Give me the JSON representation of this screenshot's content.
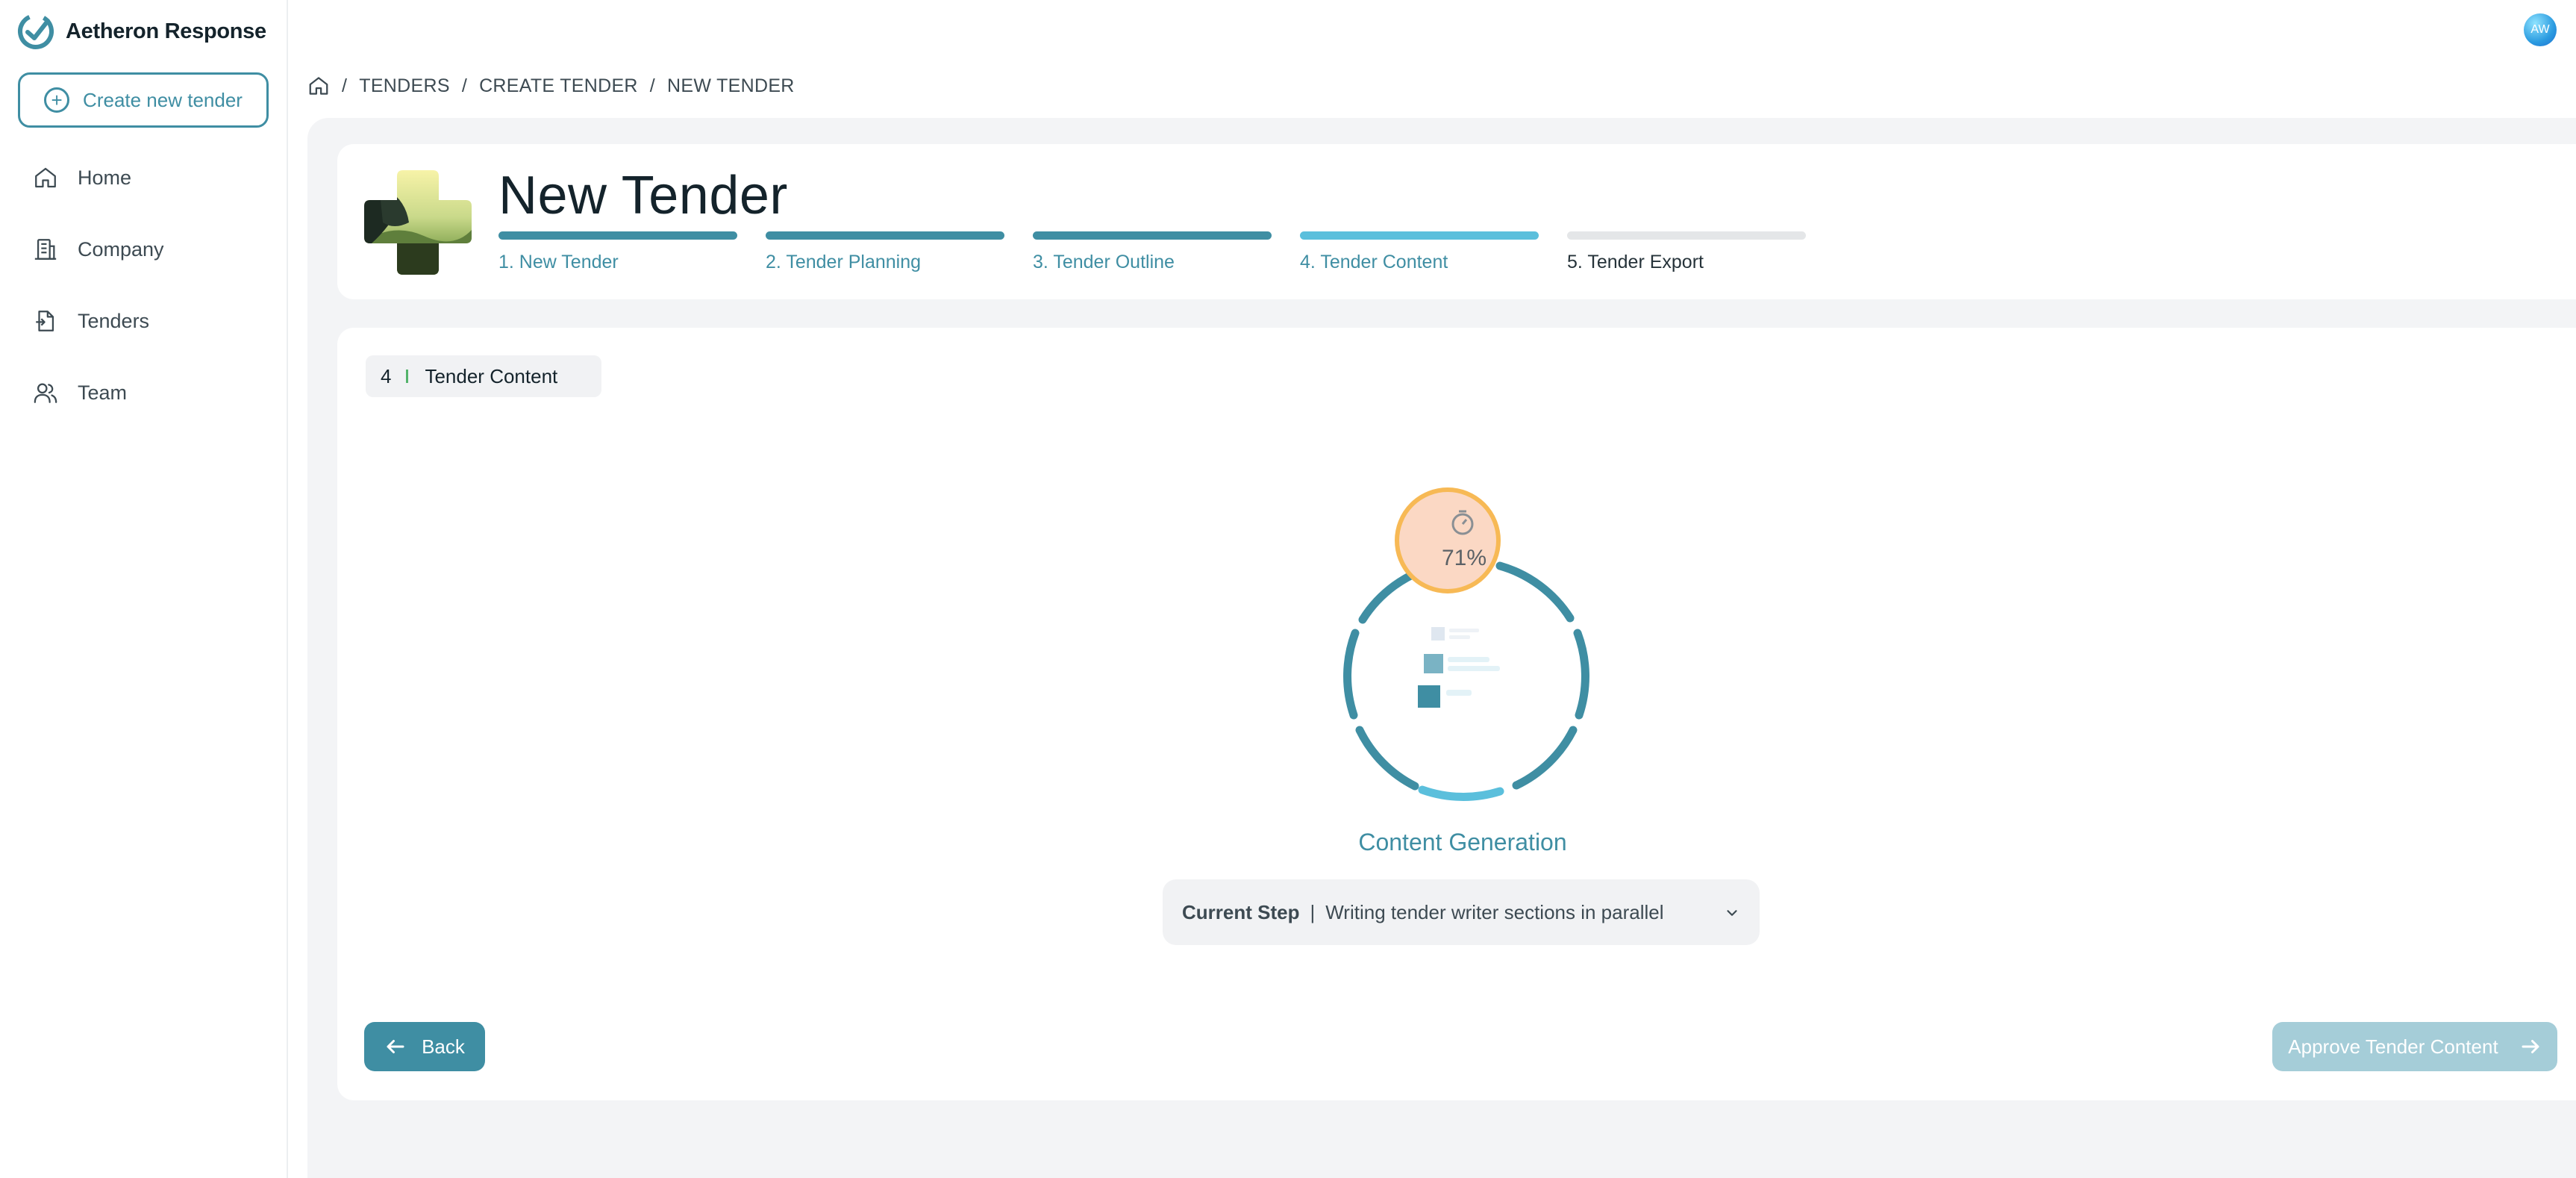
{
  "app": {
    "name": "Aetheron Response"
  },
  "sidebar": {
    "create_label": "Create new tender",
    "items": [
      {
        "label": "Home",
        "icon": "home-icon"
      },
      {
        "label": "Company",
        "icon": "building-icon"
      },
      {
        "label": "Tenders",
        "icon": "document-icon"
      },
      {
        "label": "Team",
        "icon": "users-icon"
      }
    ]
  },
  "user": {
    "initials": "AW"
  },
  "breadcrumb": [
    "TENDERS",
    "CREATE TENDER",
    "NEW TENDER"
  ],
  "header": {
    "title": "New Tender",
    "steps": [
      {
        "label": "1.  New Tender",
        "state": "done"
      },
      {
        "label": "2.  Tender Planning",
        "state": "done"
      },
      {
        "label": "3.  Tender Outline",
        "state": "done"
      },
      {
        "label": "4.  Tender Content",
        "state": "current"
      },
      {
        "label": "5.  Tender Export",
        "state": "pending"
      }
    ]
  },
  "section": {
    "number": "4",
    "title": "Tender Content"
  },
  "progress": {
    "percent_label": "71%",
    "value": 0.71,
    "icon": "stopwatch-icon"
  },
  "generation": {
    "title": "Content Generation",
    "current_step_label": "Current Step",
    "current_step_value": "Writing tender writer sections in parallel"
  },
  "actions": {
    "back_label": "Back",
    "approve_label": "Approve Tender Content"
  },
  "colors": {
    "accent": "#3f8ea3",
    "accent_light": "#5bbfdc",
    "pending": "#e4e6e8",
    "badge_orange": "#f7b955",
    "badge_fill": "#fbd8c4"
  }
}
